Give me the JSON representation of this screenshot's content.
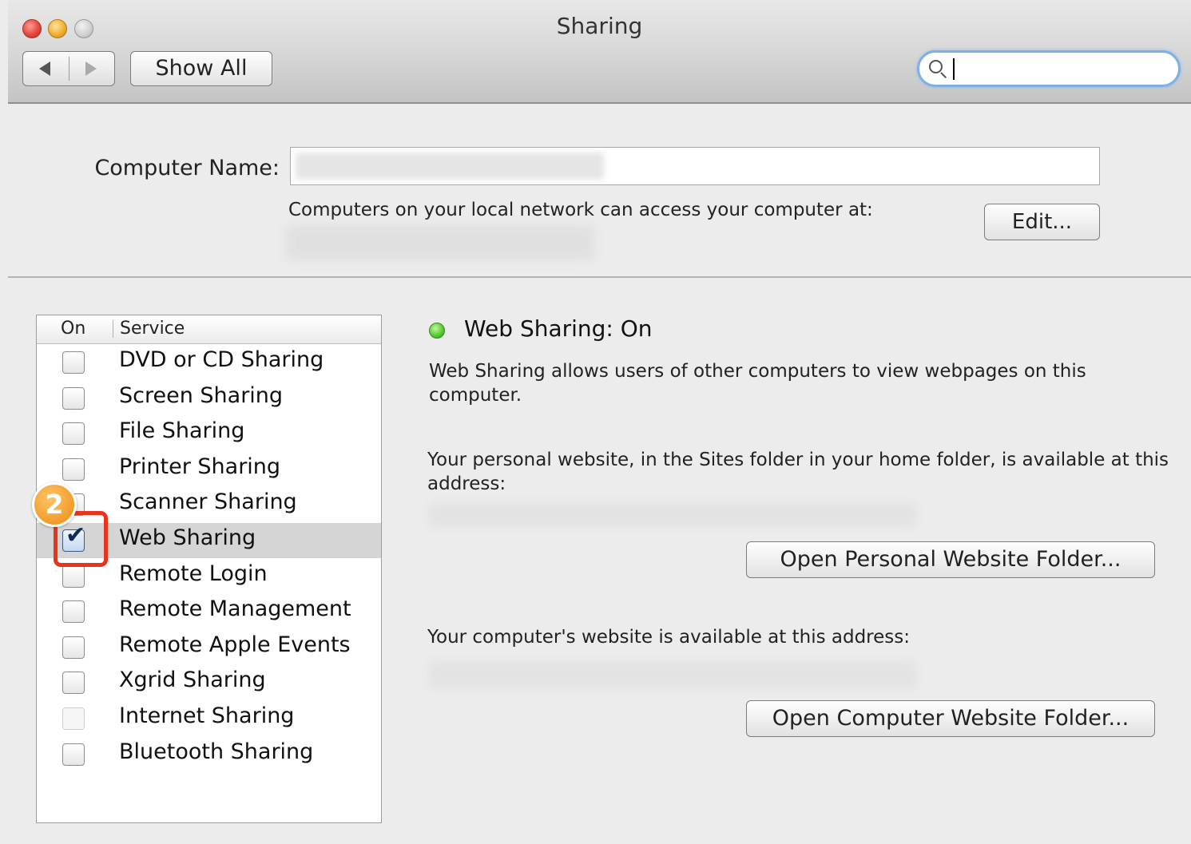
{
  "window": {
    "title": "Sharing"
  },
  "toolbar": {
    "back_icon": "chevron-left-icon",
    "forward_icon": "chevron-right-icon",
    "show_all_label": "Show All",
    "search_value": ""
  },
  "computer_name": {
    "label": "Computer Name:",
    "value": "",
    "network_text": "Computers on your local network can access your computer at:",
    "edit_label": "Edit..."
  },
  "services": {
    "header_on": "On",
    "header_service": "Service",
    "items": [
      {
        "label": "DVD or CD Sharing",
        "checked": false,
        "enabled": true
      },
      {
        "label": "Screen Sharing",
        "checked": false,
        "enabled": true
      },
      {
        "label": "File Sharing",
        "checked": false,
        "enabled": true
      },
      {
        "label": "Printer Sharing",
        "checked": false,
        "enabled": true
      },
      {
        "label": "Scanner Sharing",
        "checked": false,
        "enabled": true
      },
      {
        "label": "Web Sharing",
        "checked": true,
        "enabled": true,
        "selected": true
      },
      {
        "label": "Remote Login",
        "checked": false,
        "enabled": true
      },
      {
        "label": "Remote Management",
        "checked": false,
        "enabled": true
      },
      {
        "label": "Remote Apple Events",
        "checked": false,
        "enabled": true
      },
      {
        "label": "Xgrid Sharing",
        "checked": false,
        "enabled": true
      },
      {
        "label": "Internet Sharing",
        "checked": false,
        "enabled": false
      },
      {
        "label": "Bluetooth Sharing",
        "checked": false,
        "enabled": true
      }
    ]
  },
  "detail": {
    "status_title": "Web Sharing: On",
    "status_color": "#4fc92c",
    "description": "Web Sharing allows users of other computers to view webpages on this computer.",
    "personal_text": "Your personal website, in the Sites folder in your home folder, is available at this address:",
    "open_personal_label": "Open Personal Website Folder...",
    "computer_text": "Your computer's website is available at this address:",
    "open_computer_label": "Open Computer Website Folder..."
  },
  "annotation": {
    "step_number": "2",
    "highlight_color": "#e8341c",
    "badge_color": "#f29b2a"
  }
}
